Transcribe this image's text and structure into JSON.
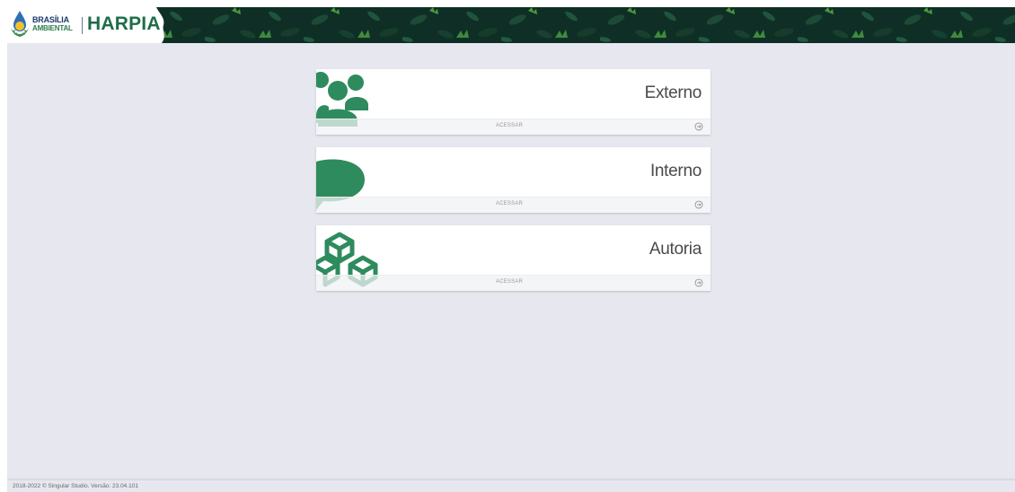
{
  "header": {
    "brand_line1": "BRASÍLIA",
    "brand_line2": "AMBIENTAL",
    "app_name": "HARPIA"
  },
  "cards": [
    {
      "title": "Externo",
      "action_label": "ACESSAR",
      "icon": "users-group-icon"
    },
    {
      "title": "Interno",
      "action_label": "ACESSAR",
      "icon": "speech-bubble-icon"
    },
    {
      "title": "Autoria",
      "action_label": "ACESSAR",
      "icon": "stacked-cubes-icon"
    }
  ],
  "footer": {
    "text": "2018-2022 © Singular Studio. Versão: 23.04.101"
  },
  "colors": {
    "header_bg": "#0f2f26",
    "accent_green": "#2e8b5e",
    "page_bg": "#e6e7ef"
  }
}
